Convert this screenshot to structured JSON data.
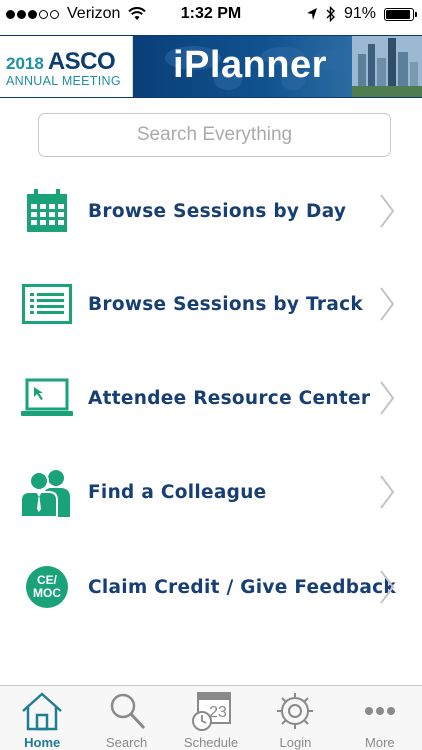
{
  "status_bar": {
    "carrier": "Verizon",
    "time": "1:32 PM",
    "battery": "91%",
    "battery_level": 0.91
  },
  "banner": {
    "logo_year": "2018",
    "logo_org": "ASCO",
    "logo_subtitle": "ANNUAL MEETING",
    "title": "iPlanner"
  },
  "search": {
    "placeholder": "Search Everything"
  },
  "menu": {
    "items": [
      {
        "label": "Browse Sessions by Day",
        "icon": "calendar-icon"
      },
      {
        "label": "Browse Sessions by Track",
        "icon": "list-icon"
      },
      {
        "label": "Attendee Resource Center",
        "icon": "laptop-icon"
      },
      {
        "label": "Find a Colleague",
        "icon": "people-icon"
      },
      {
        "label": "Claim Credit / Give Feedback",
        "icon": "ce-moc-icon",
        "badge_line1": "CE/",
        "badge_line2": "MOC"
      }
    ]
  },
  "tab_bar": {
    "tabs": [
      {
        "label": "Home",
        "icon": "home-icon",
        "active": true
      },
      {
        "label": "Search",
        "icon": "magnifier-icon"
      },
      {
        "label": "Schedule",
        "icon": "schedule-icon",
        "calendar_day": "23"
      },
      {
        "label": "Login",
        "icon": "gear-icon"
      },
      {
        "label": "More",
        "icon": "more-dots-icon"
      }
    ]
  },
  "colors": {
    "accent_green": "#1aa37a",
    "label_navy": "#173f73",
    "active_tab": "#1f7d93"
  }
}
